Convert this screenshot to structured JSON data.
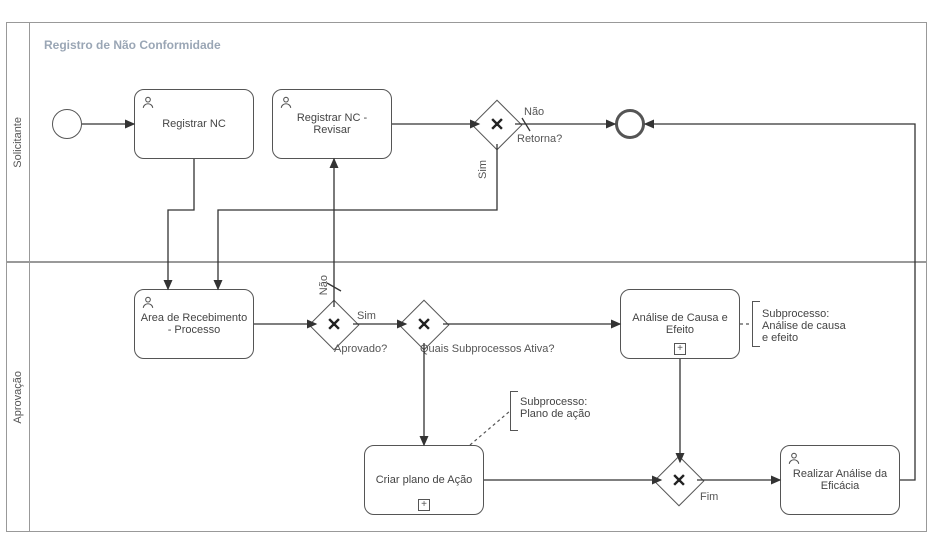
{
  "pool": {
    "title": "Registro de Não Conformidade",
    "lanes": [
      {
        "id": "solicitante",
        "label": "Solicitante"
      },
      {
        "id": "aprovacao",
        "label": "Aprovação"
      }
    ]
  },
  "tasks": {
    "registrar_nc": {
      "label": "Registrar NC",
      "type": "user"
    },
    "registrar_nc_revisar": {
      "label": "Registrar NC - Revisar",
      "type": "user"
    },
    "area_recebimento": {
      "label": "Area de Recebimento - Processo",
      "type": "user"
    },
    "analise_causa": {
      "label": "Análise de Causa e Efeito",
      "type": "subprocess"
    },
    "criar_plano": {
      "label": "Criar plano de Ação",
      "type": "subprocess"
    },
    "realizar_eficacia": {
      "label": "Realizar Análise da Eficácia",
      "type": "user"
    }
  },
  "gateways": {
    "retorna": {
      "label": "Retorna?",
      "yes": "Sim",
      "no": "Não"
    },
    "aprovado": {
      "label": "Aprovado?",
      "yes": "Sim",
      "no": "Não"
    },
    "quais_sub": {
      "label": "Quais Subprocessos Ativa?"
    },
    "fim": {
      "label": "Fim"
    }
  },
  "annotations": {
    "causa_efeito": "Subprocesso: Análise de causa e efeito",
    "plano_acao": "Subprocesso: Plano de ação"
  }
}
